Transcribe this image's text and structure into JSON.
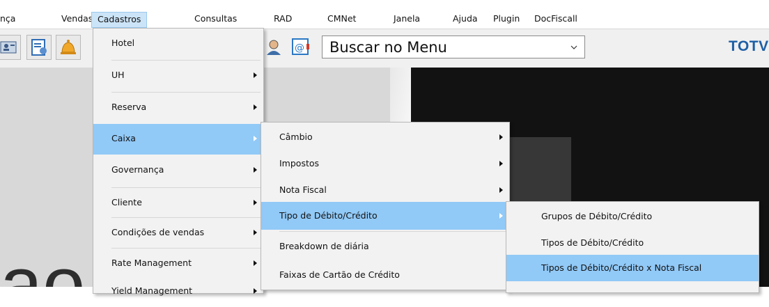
{
  "menubar": {
    "items": [
      "nça",
      "Vendas",
      "Cadastros",
      "Consultas",
      "RAD",
      "CMNet",
      "Janela",
      "Ajuda",
      "Plugin",
      "DocFiscall"
    ]
  },
  "toolbar": {
    "search_placeholder": "Buscar no Menu",
    "brand": "TOTVS",
    "icons": [
      "guest-card-icon",
      "reservation-icon",
      "bell-icon",
      "agent-icon",
      "email-icon"
    ]
  },
  "menus": {
    "cadastros": [
      "Hotel",
      "UH",
      "Reserva",
      "Caixa",
      "Governança",
      "Cliente",
      "Condições de vendas",
      "Rate Management",
      "Yield Management"
    ],
    "caixa": [
      "Câmbio",
      "Impostos",
      "Nota Fiscal",
      "Tipo de Débito/Crédito",
      "Breakdown de diária",
      "Faixas de Cartão de Crédito"
    ],
    "tipo_debito_credito": [
      "Grupos de Débito/Crédito",
      "Tipos de Débito/Crédito",
      "Tipos de Débito/Crédito x Nota Fiscal"
    ]
  },
  "background": {
    "letters": "ao"
  },
  "colors": {
    "highlight": "#91c9f7",
    "menubar_active": "#cce4f7",
    "brand": "#1d5fa6"
  }
}
